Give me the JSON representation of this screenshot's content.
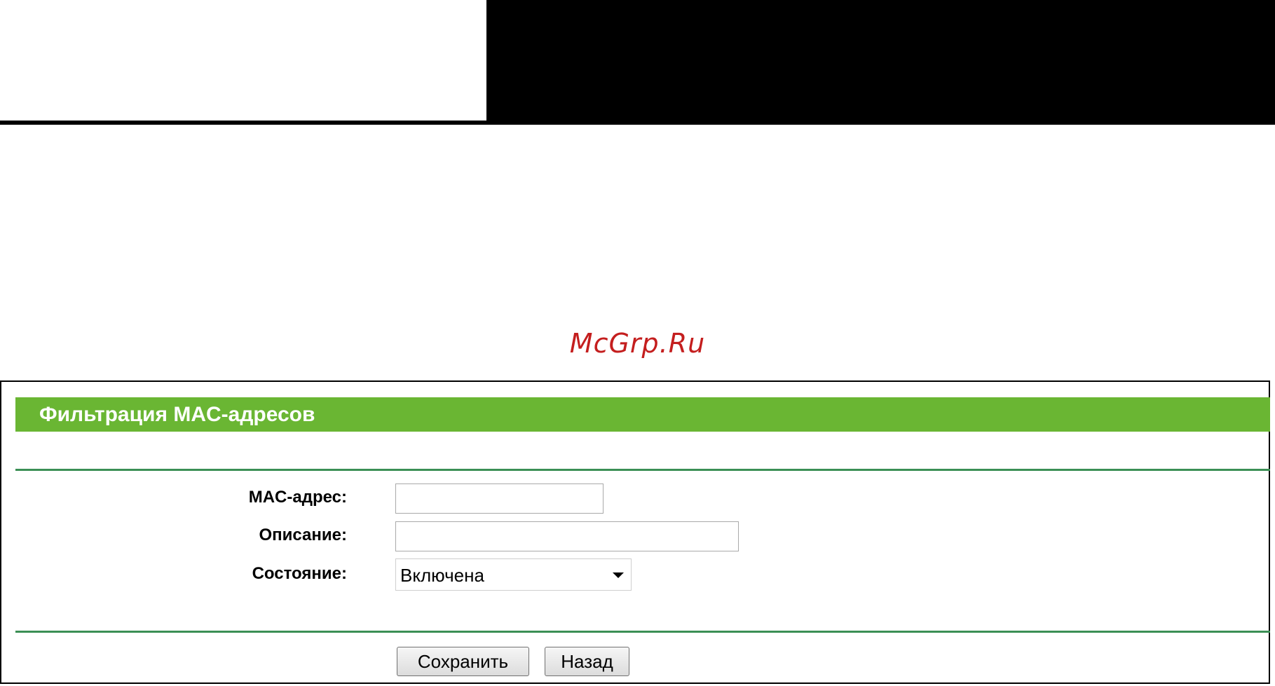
{
  "watermark": "McGrp.Ru",
  "panel": {
    "title": "Фильтрация MAC-адресов",
    "fields": {
      "mac_label": "MAC-адрес:",
      "mac_value": "",
      "description_label": "Описание:",
      "description_value": "",
      "status_label": "Состояние:",
      "status_selected": "Включена"
    },
    "buttons": {
      "save_label": "Сохранить",
      "back_label": "Назад"
    }
  },
  "colors": {
    "title_bar": "#6ab633",
    "rule": "#3b8f55",
    "watermark": "#c41e1e"
  }
}
